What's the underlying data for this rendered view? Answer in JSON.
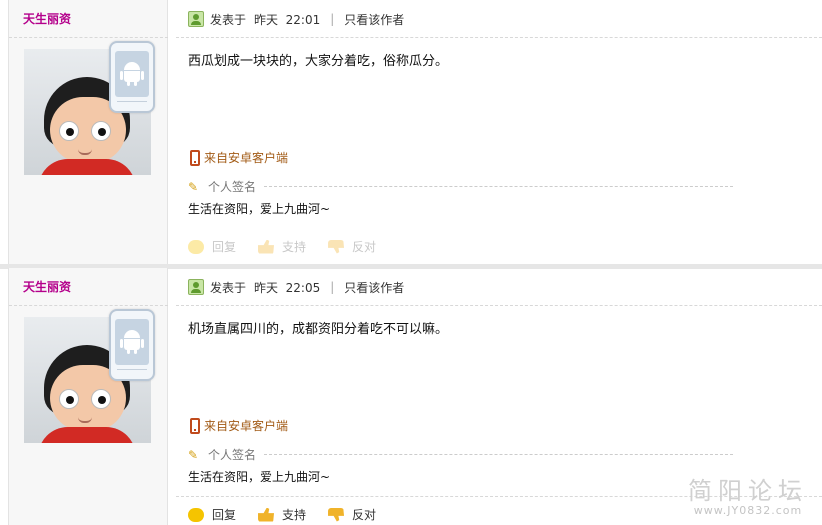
{
  "posts": [
    {
      "username": "天生丽资",
      "posted_label": "发表于",
      "posted_time": "昨天  22:01",
      "separator": "|",
      "only_author": "只看该作者",
      "content": "西瓜划成一块块的，大家分着吃，俗称瓜分。",
      "source": "来自安卓客户端",
      "signature_label": "个人签名",
      "signature": "生活在资阳，爱上九曲河~",
      "actions": {
        "reply": "回复",
        "support": "支持",
        "oppose": "反对"
      }
    },
    {
      "username": "天生丽资",
      "posted_label": "发表于",
      "posted_time": "昨天  22:05",
      "separator": "|",
      "only_author": "只看该作者",
      "content": "机场直属四川的，成都资阳分着吃不可以嘛。",
      "source": "来自安卓客户端",
      "signature_label": "个人签名",
      "signature": "生活在资阳，爱上九曲河~",
      "actions": {
        "reply": "回复",
        "support": "支持",
        "oppose": "反对"
      }
    }
  ],
  "watermark": {
    "title": "简阳论坛",
    "url": "www.JY0832.com"
  },
  "colors": {
    "username": "#b4008b",
    "source": "#a25b16",
    "sidebar_bg": "#f7f7f7"
  },
  "icons": [
    "user-meta-icon",
    "android-phone-badge-icon",
    "mobile-phone-icon",
    "pencil-icon",
    "reply-icon",
    "thumbs-up-icon",
    "thumbs-down-icon"
  ]
}
